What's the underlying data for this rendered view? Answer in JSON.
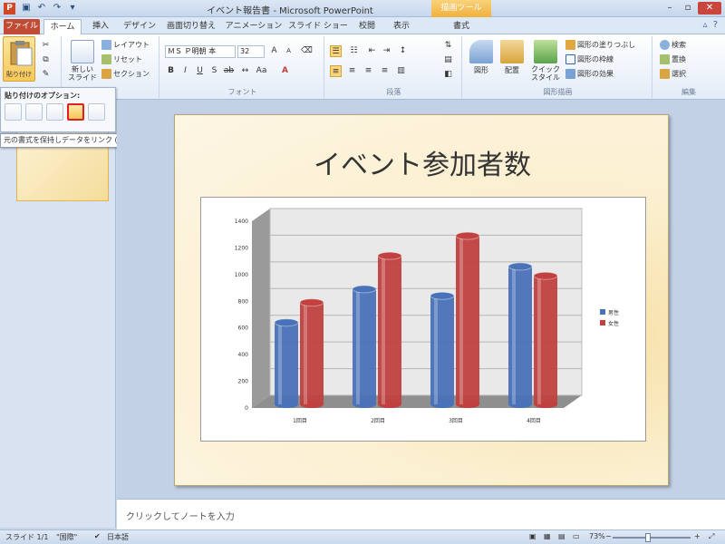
{
  "window": {
    "title": "イベント報告書 - Microsoft PowerPoint",
    "context_tab": "描画ツール"
  },
  "qat": {
    "icons": [
      "save-icon",
      "undo-icon",
      "redo-icon",
      "customize-icon"
    ]
  },
  "tabs": [
    {
      "label": "ファイル"
    },
    {
      "label": "ホーム"
    },
    {
      "label": "挿入"
    },
    {
      "label": "デザイン"
    },
    {
      "label": "画面切り替え"
    },
    {
      "label": "アニメーション"
    },
    {
      "label": "スライド ショー"
    },
    {
      "label": "校閲"
    },
    {
      "label": "表示"
    },
    {
      "label": "書式"
    }
  ],
  "ribbon": {
    "clipboard": {
      "paste_label": "貼り付け"
    },
    "slides": {
      "new_slide": "新しい\nスライド",
      "layout": "レイアウト",
      "reset": "リセット",
      "section": "セクション"
    },
    "font": {
      "font_name": "ＭＳ Ｐ明朝 本",
      "font_size": "32",
      "group_label": "フォント"
    },
    "paragraph": {
      "group_label": "段落"
    },
    "drawing": {
      "shapes": "図形",
      "arrange": "配置",
      "quick_styles": "クイック\nスタイル",
      "fill": "図形の塗りつぶし",
      "outline": "図形の枠線",
      "effects": "図形の効果",
      "group_label": "図形描画"
    },
    "editing": {
      "find": "検索",
      "replace": "置換",
      "select": "選択",
      "group_label": "編集"
    }
  },
  "paste_options": {
    "header": "貼り付けのオプション:",
    "tooltip": "元の書式を保持しデータをリンク (F)"
  },
  "slide": {
    "title": "イベント参加者数"
  },
  "chart_data": {
    "type": "bar",
    "categories": [
      "1回目",
      "2回目",
      "3回目",
      "4回目"
    ],
    "series": [
      {
        "name": "男性",
        "values": [
          600,
          850,
          800,
          1020
        ],
        "color": "#4a72b8"
      },
      {
        "name": "女性",
        "values": [
          750,
          1100,
          1250,
          950
        ],
        "color": "#c0413f"
      }
    ],
    "ylim": [
      0,
      1400
    ],
    "yticks": [
      "0",
      "200",
      "400",
      "600",
      "800",
      "1000",
      "1200",
      "1400"
    ],
    "grid": true,
    "legend_position": "right"
  },
  "notes": {
    "placeholder": "クリックしてノートを入力"
  },
  "status": {
    "slide": "スライド 1/1",
    "theme": "\"国際\"",
    "language": "日本語",
    "zoom": "73%"
  }
}
